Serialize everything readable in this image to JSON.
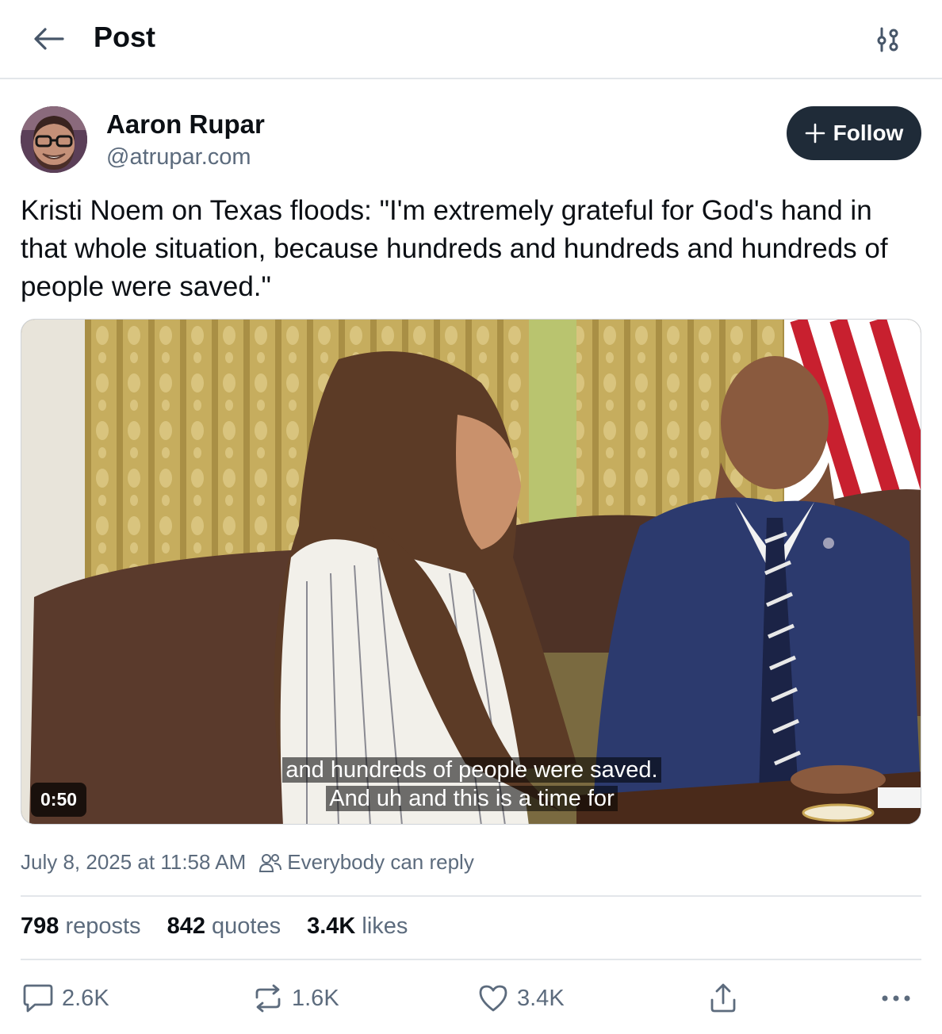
{
  "header": {
    "title": "Post",
    "back_icon": "arrow-left-icon",
    "filter_icon": "sliders-icon"
  },
  "author": {
    "name": "Aaron Rupar",
    "handle": "@atrupar.com",
    "follow_label": "Follow"
  },
  "post": {
    "text": "Kristi Noem on Texas floods: \"I'm extremely grateful for God's hand in that whole situation, because hundreds and hundreds and hundreds of people were saved.\"",
    "video": {
      "duration": "0:50",
      "caption_line1": "and hundreds of people were saved.",
      "caption_line2": "And uh and this is a time for"
    },
    "timestamp": "July 8, 2025 at 11:58 AM",
    "reply_setting": "Everybody can reply"
  },
  "stats": {
    "reposts_count": "798",
    "reposts_label": "reposts",
    "quotes_count": "842",
    "quotes_label": "quotes",
    "likes_count": "3.4K",
    "likes_label": "likes"
  },
  "actions": {
    "reply_count": "2.6K",
    "repost_count": "1.6K",
    "like_count": "3.4K"
  },
  "colors": {
    "text_primary": "#0b0f14",
    "text_secondary": "#5c6b7d",
    "follow_bg": "#1f2b38",
    "divider": "#e3e6ea"
  }
}
